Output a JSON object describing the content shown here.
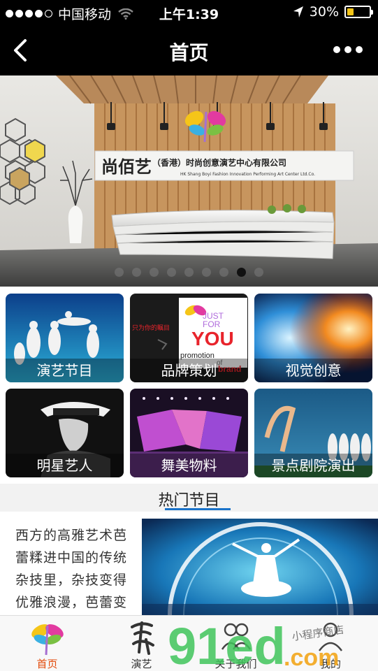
{
  "status_bar": {
    "carrier": "中国移动",
    "time": "上午1:39",
    "battery": "30%",
    "battery_level": 0.3
  },
  "nav": {
    "title": "首页",
    "back_icon": "chevron-left-icon",
    "more_icon": "more-dots-icon"
  },
  "banner": {
    "sign_text": "尚佰艺",
    "sign_subtext": "（香港）时尚创意演艺中心有限公司",
    "sign_english": "HK Shang Boyi Fashion Innovation Performing Art Center Ltd.Co.",
    "slide_count": 9,
    "active_slide": 8
  },
  "categories": [
    {
      "label": "演艺节目"
    },
    {
      "label": "品牌策划",
      "overlay": {
        "just": "JUST",
        "for": "FOR",
        "you": "YOU",
        "promo": "promotion",
        "of": "of",
        "brand": "brand",
        "side": "只为你的瞩目"
      }
    },
    {
      "label": "视觉创意"
    },
    {
      "label": "明星艺人"
    },
    {
      "label": "舞美物料"
    },
    {
      "label": "景点剧院演出"
    }
  ],
  "hot_section": {
    "title": "热门节目",
    "desc": "西方的高雅艺术芭蕾糅进中国的传统杂技里，杂技变得优雅浪漫，芭蕾变"
  },
  "tabs": [
    {
      "label": "首页",
      "icon": "dragonfly-logo-icon",
      "active": true
    },
    {
      "label": "演艺",
      "icon": "calligraphy-icon",
      "active": false
    },
    {
      "label": "关于我们",
      "icon": "people-icon",
      "active": false
    },
    {
      "label": "我的",
      "icon": "user-icon",
      "active": false
    }
  ],
  "watermark": {
    "text": "91ed",
    "domain": ".com",
    "slogan": "小程序商店"
  },
  "colors": {
    "accent": "#1a73c9",
    "active_tab": "#e24a0a",
    "battery": "#f5c518"
  }
}
